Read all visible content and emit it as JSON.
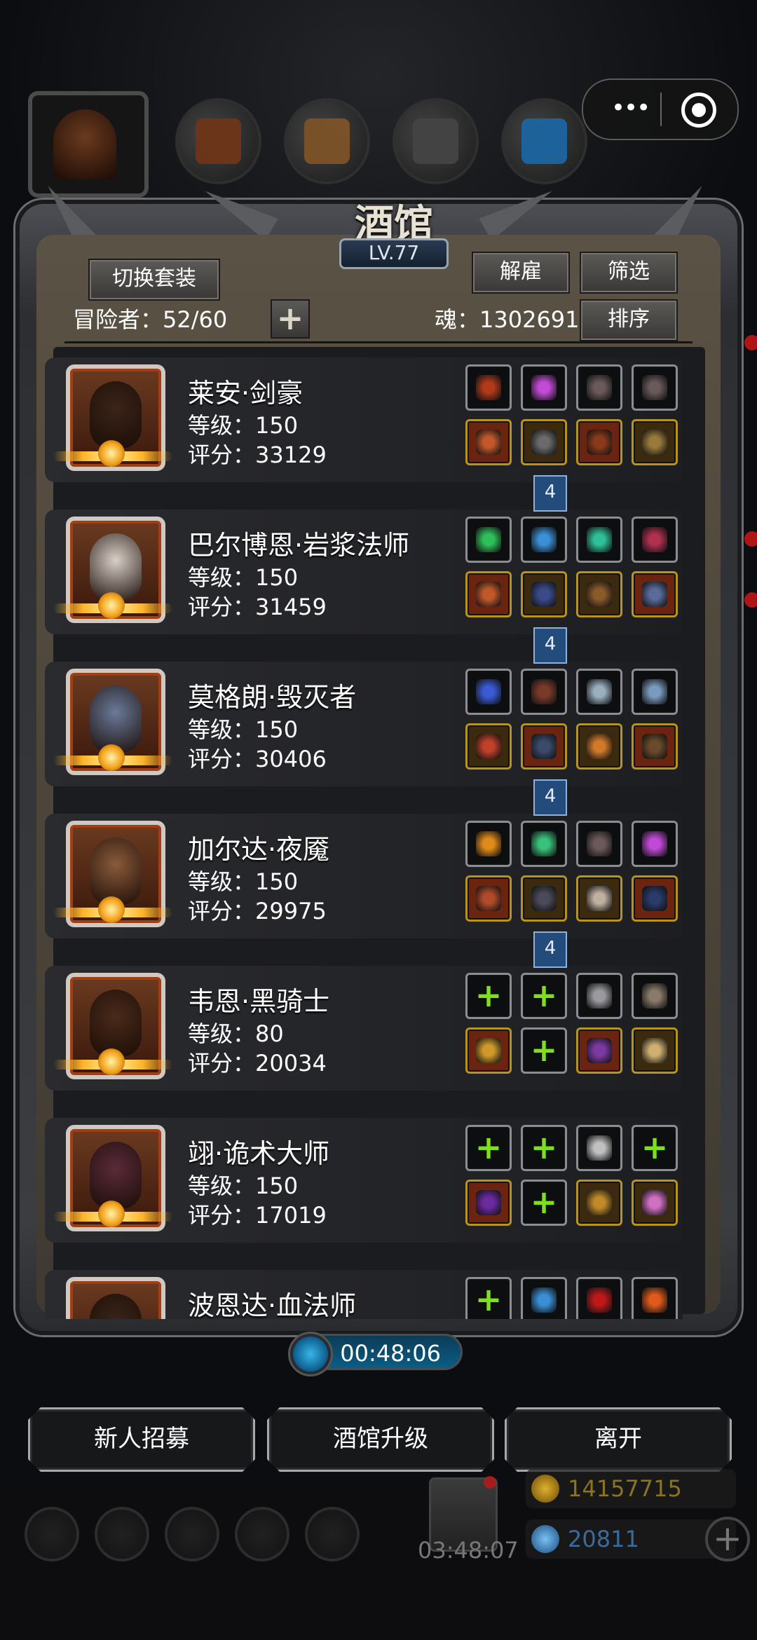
{
  "capsule": {
    "more_icon": "more-dots-icon",
    "close_icon": "target-circle-icon"
  },
  "tavern": {
    "title": "酒馆",
    "level": "LV.77",
    "switch_outfit": "切换套装",
    "dismiss": "解雇",
    "filter": "筛选",
    "sort": "排序",
    "adventurers_label": "冒险者：52/60",
    "soul_label": "魂：1302691"
  },
  "connectors": [
    "4",
    "4",
    "4",
    "4"
  ],
  "heroes": [
    {
      "name": "莱安·剑豪",
      "level": "等级：150",
      "score": "评分：33129",
      "face": "#3b2418",
      "slots": [
        [
          "#b03a1a",
          "gray"
        ],
        [
          "#c24bd6",
          "gray"
        ],
        [
          "#6a5a5a",
          "gray"
        ],
        [
          "#6a5a5a",
          "gray"
        ],
        [
          "#c0582a",
          "red"
        ],
        [
          "#6a6a6a",
          "gold"
        ],
        [
          "#8a3a1a",
          "red"
        ],
        [
          "#9a7a3a",
          "gold"
        ]
      ]
    },
    {
      "name": "巴尔博恩·岩浆法师",
      "level": "等级：150",
      "score": "评分：31459",
      "face": "#d8d0c8",
      "slots": [
        [
          "#2fbf5a",
          "gray"
        ],
        [
          "#3a8fd6",
          "gray"
        ],
        [
          "#2fbf9a",
          "gray"
        ],
        [
          "#b03050",
          "gray"
        ],
        [
          "#c0582a",
          "red"
        ],
        [
          "#3a4a8a",
          "gold"
        ],
        [
          "#8a5a2a",
          "gold"
        ],
        [
          "#5a6a9a",
          "red"
        ]
      ]
    },
    {
      "name": "莫格朗·毁灭者",
      "level": "等级：150",
      "score": "评分：30406",
      "face": "#6a7a9a",
      "slots": [
        [
          "#3a5ad6",
          "gray"
        ],
        [
          "#7a3a2a",
          "gray"
        ],
        [
          "#9ab0c0",
          "gray"
        ],
        [
          "#7a9ac0",
          "gray"
        ],
        [
          "#c0402a",
          "gold"
        ],
        [
          "#3a4a6a",
          "red"
        ],
        [
          "#d07a2a",
          "gold"
        ],
        [
          "#6a4a2a",
          "red"
        ]
      ]
    },
    {
      "name": "加尔达·夜魇",
      "level": "等级：150",
      "score": "评分：29975",
      "face": "#8a5a3a",
      "slots": [
        [
          "#e08a1a",
          "gray"
        ],
        [
          "#3ac07a",
          "gray"
        ],
        [
          "#6a5a5a",
          "gray"
        ],
        [
          "#c04ad6",
          "gray"
        ],
        [
          "#b04a2a",
          "red"
        ],
        [
          "#4a4a5a",
          "gold"
        ],
        [
          "#c0b0a0",
          "gold"
        ],
        [
          "#2a3a6a",
          "red"
        ]
      ]
    },
    {
      "name": "韦恩·黑骑士",
      "level": "等级：80",
      "score": "评分：20034",
      "face": "#4a2a1a",
      "slots": [
        [
          "plus",
          "gray"
        ],
        [
          "plus",
          "gray"
        ],
        [
          "#9a9aa0",
          "gray"
        ],
        [
          "#8a7a6a",
          "gray"
        ],
        [
          "#d09a2a",
          "red"
        ],
        [
          "plus",
          "gray"
        ],
        [
          "#7a3aa0",
          "red"
        ],
        [
          "#d0b070",
          "gold"
        ]
      ]
    },
    {
      "name": "翊·诡术大师",
      "level": "等级：150",
      "score": "评分：17019",
      "face": "#5a2a3a",
      "slots": [
        [
          "plus",
          "gray"
        ],
        [
          "plus",
          "gray"
        ],
        [
          "#c0c0c0",
          "gray"
        ],
        [
          "plus",
          "gray"
        ],
        [
          "#6a2aa0",
          "red"
        ],
        [
          "plus",
          "gray"
        ],
        [
          "#c08a2a",
          "gold"
        ],
        [
          "#d070c0",
          "gold"
        ]
      ]
    },
    {
      "name": "波恩达·血法师",
      "level": "",
      "score": "",
      "face": "#3a2418",
      "slots": [
        [
          "plus",
          "gray"
        ],
        [
          "#3a8fd6",
          "gray"
        ],
        [
          "#c01818",
          "gray"
        ],
        [
          "#e05a1a",
          "gray"
        ]
      ]
    }
  ],
  "timer": "00:48:06",
  "bottom_buttons": {
    "recruit": "新人招募",
    "upgrade": "酒馆升级",
    "leave": "离开"
  },
  "chest_timer": "03:48:07",
  "resources": {
    "gold": "14157715",
    "gems": "20811"
  }
}
